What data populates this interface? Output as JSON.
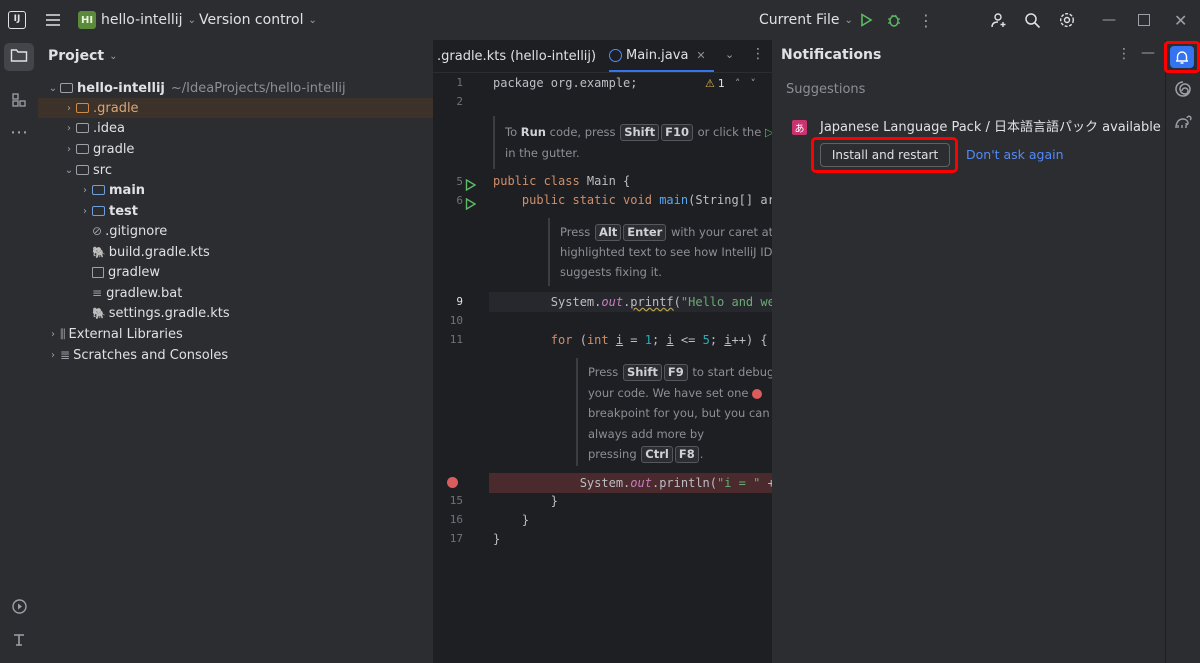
{
  "titlebar": {
    "project_badge": "HI",
    "project_name": "hello-intellij",
    "vcs_label": "Version control",
    "run_config": "Current File"
  },
  "project_panel": {
    "title": "Project",
    "root": {
      "name": "hello-intellij",
      "path": "~/IdeaProjects/hello-intellij"
    },
    "items": [
      {
        "label": ".gradle"
      },
      {
        "label": ".idea"
      },
      {
        "label": "gradle"
      },
      {
        "label": "src"
      },
      {
        "label": "main"
      },
      {
        "label": "test"
      },
      {
        "label": ".gitignore"
      },
      {
        "label": "build.gradle.kts"
      },
      {
        "label": "gradlew"
      },
      {
        "label": "gradlew.bat"
      },
      {
        "label": "settings.gradle.kts"
      },
      {
        "label": "External Libraries"
      },
      {
        "label": "Scratches and Consoles"
      }
    ]
  },
  "editor": {
    "tabs": [
      {
        "label": ".gradle.kts (hello-intellij)"
      },
      {
        "label": "Main.java"
      }
    ],
    "warning_count": "1",
    "line_numbers": [
      "1",
      "2",
      "5",
      "6",
      "9",
      "10",
      "11",
      "15",
      "16",
      "17"
    ],
    "code": {
      "l1": "package org.example;",
      "l5": "public class Main {",
      "l6": "    public static void main(String[] args",
      "l9": "        System.out.printf(\"Hello and welc",
      "l11": "        for (int i = 1; i <= 5; i++) {",
      "l14": "            System.out.println(\"i = \" + i",
      "l15": "        }",
      "l16": "    }",
      "l17": "}"
    },
    "hint1": {
      "to": "To",
      "run": "Run",
      "code_press": "code, press",
      "key1": "Shift",
      "key2": "F10",
      "or_click": "or click the",
      "icon": "icon",
      "in_gutter": "in the gutter."
    },
    "hint2": {
      "press": "Press",
      "key1": "Alt",
      "key2": "Enter",
      "line1_rest": "with your caret at the",
      "line2": "highlighted text to see how IntelliJ IDEA",
      "line3": "suggests fixing it."
    },
    "hint3": {
      "press": "Press",
      "key1": "Shift",
      "key2": "F9",
      "line1_rest": "to start debugging",
      "line2": "your code. We have set one",
      "line3": "breakpoint for you, but you can",
      "line4": "always add more by",
      "pressing": "pressing",
      "key3": "Ctrl",
      "key4": "F8",
      "period": "."
    }
  },
  "notifications": {
    "title": "Notifications",
    "section": "Suggestions",
    "item": {
      "text": "Japanese Language Pack / 日本語言語パック available",
      "icon_glyph": "あ",
      "primary_action": "Install and restart",
      "secondary_action": "Don't ask again"
    }
  },
  "colors": {
    "accent": "#3574f0",
    "highlight_box": "#ff0000",
    "link": "#548af7",
    "breakpoint": "#db5c5c"
  }
}
